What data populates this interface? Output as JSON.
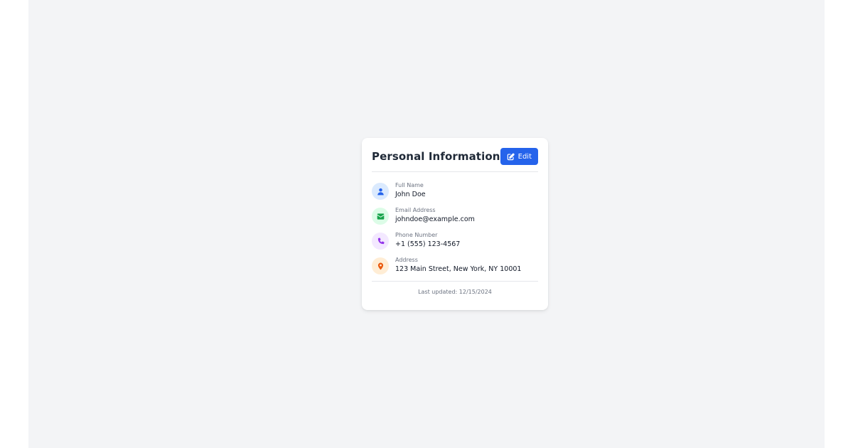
{
  "card": {
    "title": "Personal Information",
    "edit_label": "Edit",
    "fields": [
      {
        "label": "Full Name",
        "value": "John Doe",
        "icon": "user-icon",
        "color": "#2563eb"
      },
      {
        "label": "Email Address",
        "value": "johndoe@example.com",
        "icon": "envelope-icon",
        "color": "#16a34a"
      },
      {
        "label": "Phone Number",
        "value": "+1 (555) 123-4567",
        "icon": "phone-icon",
        "color": "#9333ea"
      },
      {
        "label": "Address",
        "value": "123 Main Street, New York, NY 10001",
        "icon": "map-pin-icon",
        "color": "#ea580c"
      }
    ],
    "footer": "Last updated: 12/15/2024"
  },
  "colors": {
    "accent": "#2563eb",
    "background": "#f3f4f6",
    "card": "#ffffff"
  }
}
